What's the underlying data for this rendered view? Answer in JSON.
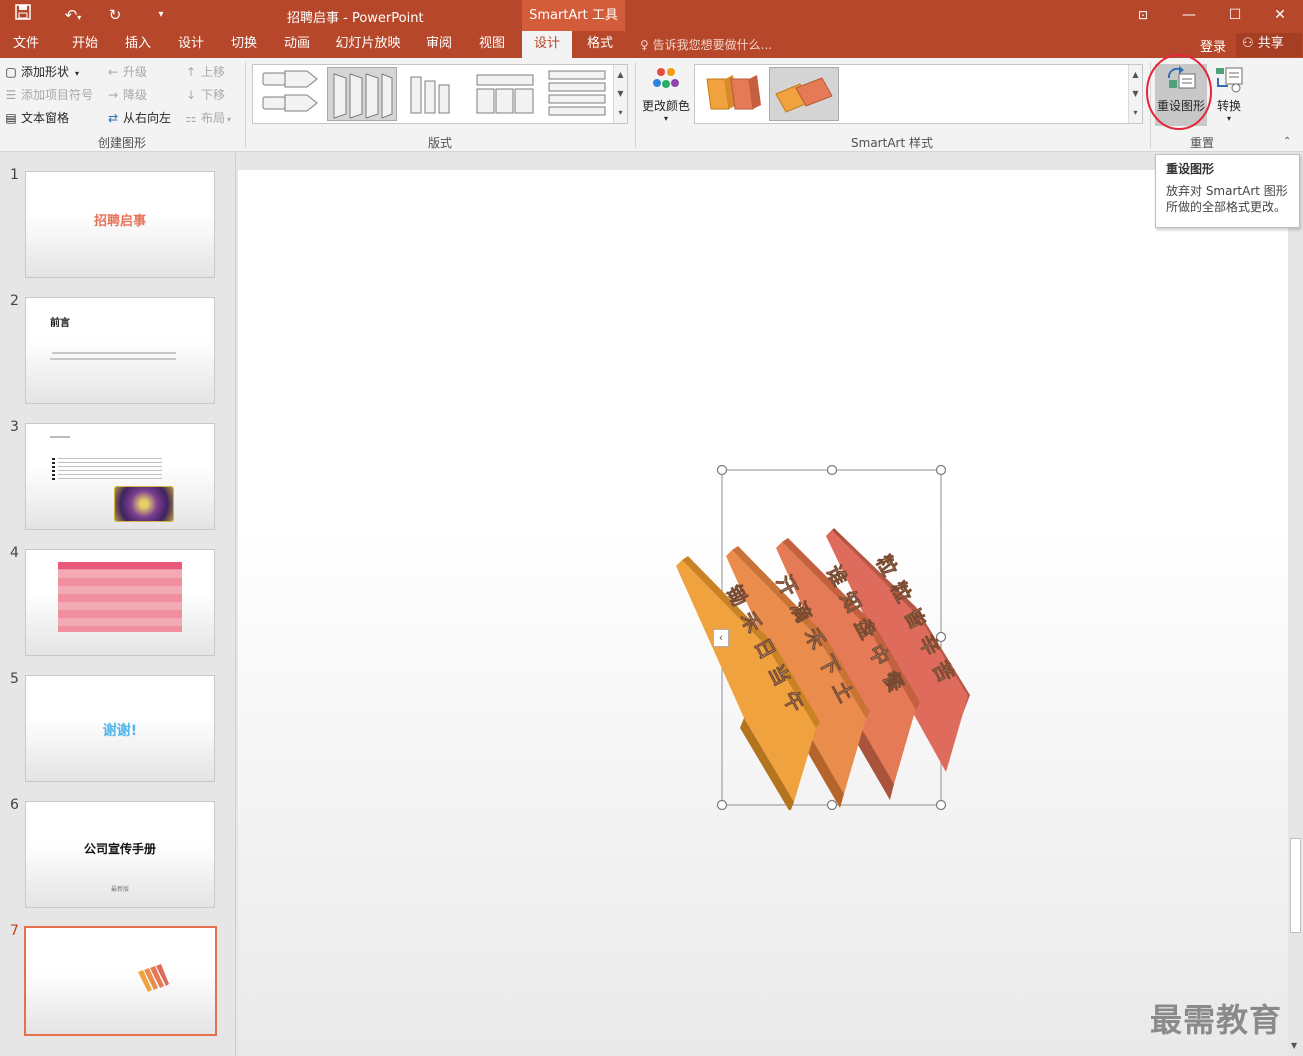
{
  "window": {
    "title": "招聘启事 - PowerPoint",
    "context_tool": "SmartArt 工具",
    "controls": [
      "restore-ribbon-icon",
      "minimize-icon",
      "maximize-icon",
      "close-icon"
    ]
  },
  "qat": [
    "save-icon",
    "undo-icon",
    "redo-icon",
    "customize-icon"
  ],
  "tabs": [
    "文件",
    "开始",
    "插入",
    "设计",
    "切换",
    "动画",
    "幻灯片放映",
    "审阅",
    "视图",
    "设计",
    "格式"
  ],
  "active_tab_index": 9,
  "tell_me": "告诉我您想要做什么...",
  "account": {
    "login": "登录",
    "share": "共享"
  },
  "ribbon": {
    "create_graphic": {
      "label": "创建图形",
      "add_shape": "添加形状",
      "add_bullet": "添加项目符号",
      "text_pane": "文本窗格",
      "promote": "升级",
      "demote": "降级",
      "right_to_left": "从右向左",
      "move_up": "上移",
      "move_down": "下移",
      "layout": "布局"
    },
    "layouts": {
      "label": "版式"
    },
    "styles": {
      "label": "SmartArt 样式",
      "change_colors": "更改颜色"
    },
    "reset": {
      "label": "重置",
      "reset_graphic": "重设图形",
      "convert": "转换"
    }
  },
  "tooltip": {
    "title": "重设图形",
    "body_line1": "放弃对 SmartArt 图形",
    "body_line2": "所做的全部格式更改。"
  },
  "slides": [
    {
      "num": "1",
      "title": "招聘启事"
    },
    {
      "num": "2",
      "title": "前言"
    },
    {
      "num": "3",
      "title": ""
    },
    {
      "num": "4",
      "title": ""
    },
    {
      "num": "5",
      "title": "谢谢!"
    },
    {
      "num": "6",
      "title": "公司宣传手册",
      "subtitle": "最新版"
    },
    {
      "num": "7",
      "title": ""
    }
  ],
  "active_slide": 7,
  "smartart": {
    "strips": [
      "锄禾日当午",
      "汗滴禾下土",
      "谁知盘中餐",
      "粒粒皆辛苦"
    ],
    "colors": [
      "#f0a23e",
      "#ea8c4c",
      "#e57a56",
      "#de6b5c"
    ]
  },
  "watermark": "最需教育"
}
